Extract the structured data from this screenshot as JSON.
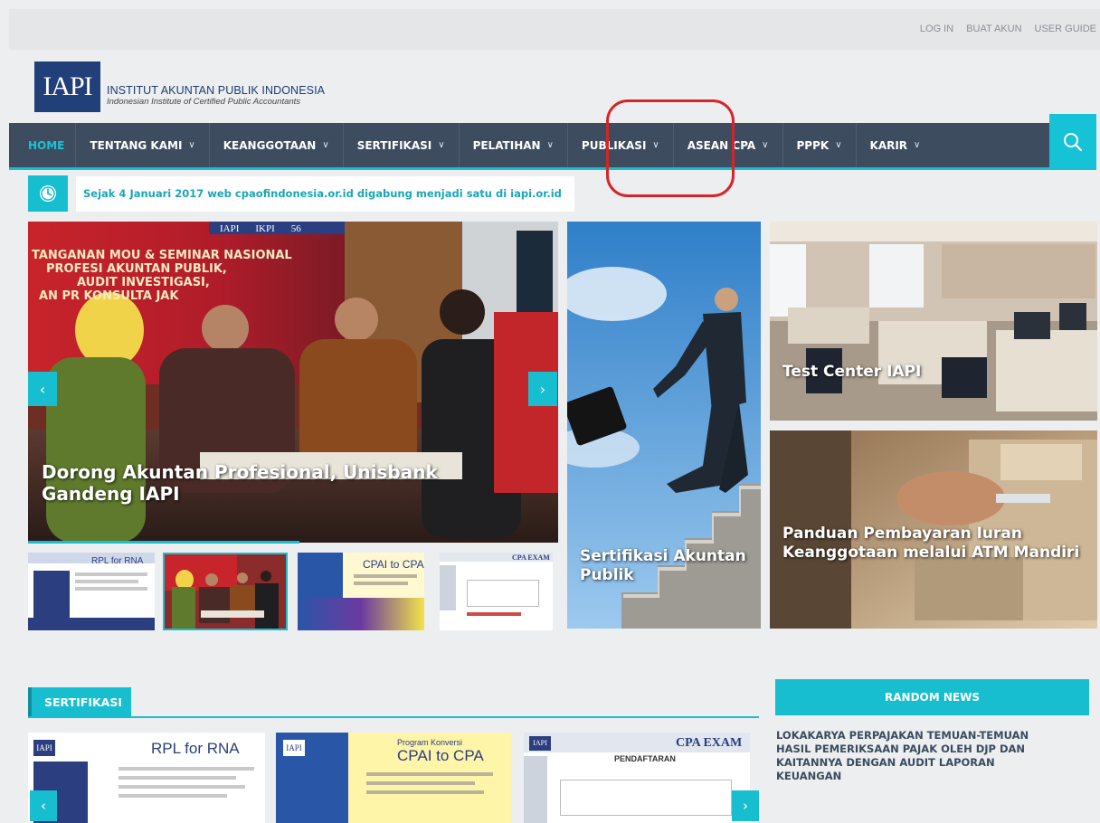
{
  "top_links": [
    "LOG IN",
    "BUAT AKUN",
    "USER GUIDE"
  ],
  "logo": {
    "mark": "IAPI",
    "title": "INSTITUT AKUNTAN PUBLIK INDONESIA",
    "subtitle": "Indonesian Institute of Certified Public Accountants"
  },
  "nav": {
    "items": [
      {
        "label": "HOME",
        "active": true
      },
      {
        "label": "TENTANG KAMI"
      },
      {
        "label": "KEANGGOTAAN"
      },
      {
        "label": "SERTIFIKASI"
      },
      {
        "label": "PELATIHAN"
      },
      {
        "label": "PUBLIKASI"
      },
      {
        "label": "ASEAN CPA"
      },
      {
        "label": "PPPK"
      },
      {
        "label": "KARIR"
      }
    ],
    "chevron": "∨",
    "search_icon": "search-icon"
  },
  "ticker": {
    "icon": "clock-icon",
    "text": "Sejak 4 Januari 2017 web cpaofindonesia.or.id digabung menjadi satu di iapi.or.id"
  },
  "slider": {
    "caption": "Dorong Akuntan Profesional, Unisbank Gandeng IAPI",
    "banner_lines": [
      "TANGANAN MOU & SEMINAR NASIONAL",
      "PROFESI AKUNTAN PUBLIK,",
      "AUDIT INVESTIGASI,",
      "AN PR  KONSULTA  JAK"
    ],
    "banner_logos": [
      "IAPI",
      "IKPI",
      "56"
    ],
    "prev": "‹",
    "next": "›"
  },
  "thumbnails": [
    {
      "label": "RPL for RNA"
    },
    {
      "label": ""
    },
    {
      "label": "CPAI to CPA"
    },
    {
      "label": "CPA EXAM"
    }
  ],
  "tiles": {
    "sertifikasi": "Sertifikasi Akuntan Publik",
    "test_center": "Test Center IAPI",
    "panduan": "Panduan Pembayaran Iuran Keanggotaan melalui ATM Mandiri"
  },
  "section": {
    "title": "SERTIFIKASI",
    "cards": [
      {
        "title": "RPL for RNA",
        "logo": "IAPI"
      },
      {
        "title": "CPAI to CPA",
        "kicker": "Program Konversi",
        "logo": "IAPI"
      },
      {
        "title": "CPA EXAM",
        "sub": "PENDAFTARAN",
        "logo": "IAPI"
      }
    ],
    "prev": "‹",
    "next": "›"
  },
  "random_news": {
    "title": "RANDOM NEWS",
    "headline": "LOKAKARYA PERPAJAKAN TEMUAN-TEMUAN HASIL PEMERIKSAAN PAJAK OLEH DJP DAN KAITANNYA DENGAN AUDIT LAPORAN KEUANGAN"
  },
  "colors": {
    "accent": "#17bed0",
    "nav_bg": "#3d4d5f",
    "logo_blue": "#213f79",
    "highlight_red": "#d72428"
  }
}
